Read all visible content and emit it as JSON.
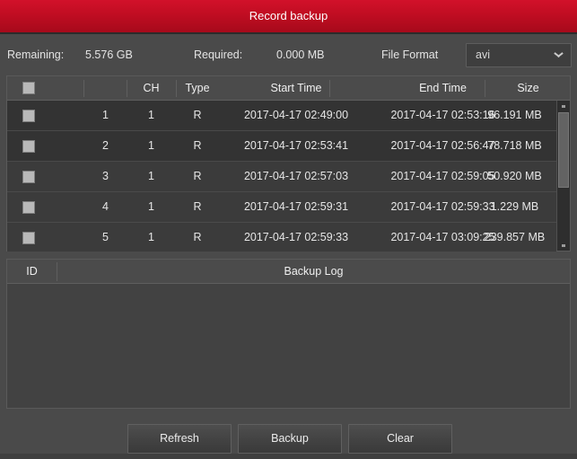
{
  "window": {
    "title": "Record backup"
  },
  "infobar": {
    "remaining_label": "Remaining:",
    "remaining_value": "5.576 GB",
    "required_label": "Required:",
    "required_value": "0.000 MB",
    "file_format_label": "File Format",
    "file_format_value": "avi",
    "file_format_options": [
      "avi"
    ],
    "dropdown_icon": "chevron-down-icon"
  },
  "record_table": {
    "columns": {
      "select_all": "",
      "index": "",
      "ch": "CH",
      "type": "Type",
      "start_time": "Start Time",
      "end_time": "End Time",
      "size": "Size"
    },
    "rows": [
      {
        "checked": false,
        "index": "1",
        "ch": "1",
        "type": "R",
        "start_time": "2017-04-17 02:49:00",
        "end_time": "2017-04-17 02:53:16",
        "size": "96.191 MB"
      },
      {
        "checked": false,
        "index": "2",
        "ch": "1",
        "type": "R",
        "start_time": "2017-04-17 02:53:41",
        "end_time": "2017-04-17 02:56:47",
        "size": "78.718 MB"
      },
      {
        "checked": false,
        "index": "3",
        "ch": "1",
        "type": "R",
        "start_time": "2017-04-17 02:57:03",
        "end_time": "2017-04-17 02:59:05",
        "size": "50.920 MB"
      },
      {
        "checked": false,
        "index": "4",
        "ch": "1",
        "type": "R",
        "start_time": "2017-04-17 02:59:31",
        "end_time": "2017-04-17 02:59:33",
        "size": "1.229 MB"
      },
      {
        "checked": false,
        "index": "5",
        "ch": "1",
        "type": "R",
        "start_time": "2017-04-17 02:59:33",
        "end_time": "2017-04-17 03:09:25",
        "size": "239.857 MB"
      }
    ],
    "scrollbar": {
      "up_icon": "scroll-up-arrow-icon",
      "down_icon": "scroll-down-arrow-icon"
    }
  },
  "backup_log": {
    "columns": {
      "id": "ID",
      "log": "Backup Log"
    },
    "rows": []
  },
  "buttons": {
    "refresh": "Refresh",
    "backup": "Backup",
    "clear": "Clear"
  },
  "colors": {
    "titlebar_red": "#c00d22",
    "window_bg": "#4a4a4a",
    "panel_bg": "#424242",
    "header_bg": "#4b4b4b",
    "text": "#e6e6e6"
  }
}
